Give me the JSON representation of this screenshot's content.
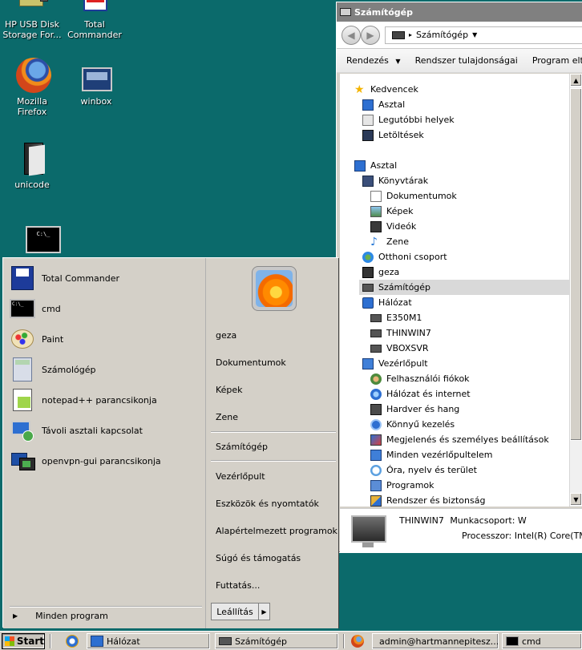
{
  "desktop": {
    "icons": [
      {
        "label": "HP USB Disk Storage For...",
        "icon": "usb-drive-icon"
      },
      {
        "label": "Total Commander",
        "icon": "total-commander-icon"
      },
      {
        "label": "Mozilla Firefox",
        "icon": "firefox-icon"
      },
      {
        "label": "winbox",
        "icon": "winbox-icon"
      },
      {
        "label": "unicode",
        "icon": "folder-icon"
      },
      {
        "label": "",
        "icon": "cmd-icon"
      }
    ]
  },
  "explorer": {
    "title": "Számítógép",
    "address": "Számítógép",
    "toolbar": {
      "organize": "Rendezés",
      "system_properties": "Rendszer tulajdonságai",
      "uninstall": "Program eltávolít"
    },
    "tree": [
      {
        "label": "Kedvencek",
        "icon": "star-icon",
        "level": 0
      },
      {
        "label": "Asztal",
        "icon": "desktop-icon",
        "level": 1
      },
      {
        "label": "Legutóbbi helyek",
        "icon": "recent-places-icon",
        "level": 1
      },
      {
        "label": "Letöltések",
        "icon": "downloads-icon",
        "level": 1
      },
      {
        "label": "Asztal",
        "icon": "desktop-icon",
        "level": 0
      },
      {
        "label": "Könyvtárak",
        "icon": "libraries-icon",
        "level": 1
      },
      {
        "label": "Dokumentumok",
        "icon": "documents-icon",
        "level": 2
      },
      {
        "label": "Képek",
        "icon": "pictures-icon",
        "level": 2
      },
      {
        "label": "Videók",
        "icon": "videos-icon",
        "level": 2
      },
      {
        "label": "Zene",
        "icon": "music-icon",
        "level": 2
      },
      {
        "label": "Otthoni csoport",
        "icon": "homegroup-icon",
        "level": 1
      },
      {
        "label": "geza",
        "icon": "user-folder-icon",
        "level": 1
      },
      {
        "label": "Számítógép",
        "icon": "computer-icon",
        "level": 1,
        "selected": true
      },
      {
        "label": "Hálózat",
        "icon": "network-icon",
        "level": 1
      },
      {
        "label": "E350M1",
        "icon": "computer-icon",
        "level": 2
      },
      {
        "label": "THINWIN7",
        "icon": "computer-icon",
        "level": 2
      },
      {
        "label": "VBOXSVR",
        "icon": "computer-icon",
        "level": 2
      },
      {
        "label": "Vezérlőpult",
        "icon": "control-panel-icon",
        "level": 1
      },
      {
        "label": "Felhasználói fiókok",
        "icon": "user-accounts-icon",
        "level": 2
      },
      {
        "label": "Hálózat és internet",
        "icon": "network-internet-icon",
        "level": 2
      },
      {
        "label": "Hardver és hang",
        "icon": "hardware-sound-icon",
        "level": 2
      },
      {
        "label": "Könnyű kezelés",
        "icon": "ease-of-access-icon",
        "level": 2
      },
      {
        "label": "Megjelenés és személyes beállítások",
        "icon": "appearance-icon",
        "level": 2
      },
      {
        "label": "Minden vezérlőpultelem",
        "icon": "control-panel-items-icon",
        "level": 2
      },
      {
        "label": "Óra, nyelv és terület",
        "icon": "clock-language-icon",
        "level": 2
      },
      {
        "label": "Programok",
        "icon": "programs-icon",
        "level": 2
      },
      {
        "label": "Rendszer és biztonság",
        "icon": "system-security-icon",
        "level": 2
      }
    ],
    "details": {
      "computer_name": "THINWIN7",
      "workgroup": "Munkacsoport: W",
      "processor": "Processzor: Intel(R) Core(TM) i"
    }
  },
  "start_menu": {
    "programs": [
      {
        "label": "Total Commander",
        "icon": "total-commander-icon"
      },
      {
        "label": "cmd",
        "icon": "cmd-icon"
      },
      {
        "label": "Paint",
        "icon": "paint-icon"
      },
      {
        "label": "Számológép",
        "icon": "calculator-icon"
      },
      {
        "label": "notepad++ parancsikonja",
        "icon": "notepad-plus-plus-icon"
      },
      {
        "label": "Távoli asztali kapcsolat",
        "icon": "remote-desktop-icon"
      },
      {
        "label": "openvpn-gui parancsikonja",
        "icon": "openvpn-icon"
      }
    ],
    "all_programs": "Minden program",
    "right": [
      {
        "label": "geza"
      },
      {
        "label": "Dokumentumok"
      },
      {
        "label": "Képek"
      },
      {
        "label": "Zene"
      },
      {
        "label": "Számítógép"
      },
      {
        "label": "Vezérlőpult"
      },
      {
        "label": "Eszközök és nyomtatók"
      },
      {
        "label": "Alapértelmezett programok"
      },
      {
        "label": "Súgó és támogatás"
      },
      {
        "label": "Futtatás..."
      }
    ],
    "shutdown": "Leállítás"
  },
  "taskbar": {
    "start": "Start",
    "buttons": [
      {
        "label": "Hálózat",
        "icon": "network-icon"
      },
      {
        "label": "Számítógép",
        "icon": "computer-icon"
      },
      {
        "label": "admin@hartmannepitesz...",
        "icon": "browser-icon"
      },
      {
        "label": "cmd",
        "icon": "cmd-icon"
      }
    ]
  }
}
